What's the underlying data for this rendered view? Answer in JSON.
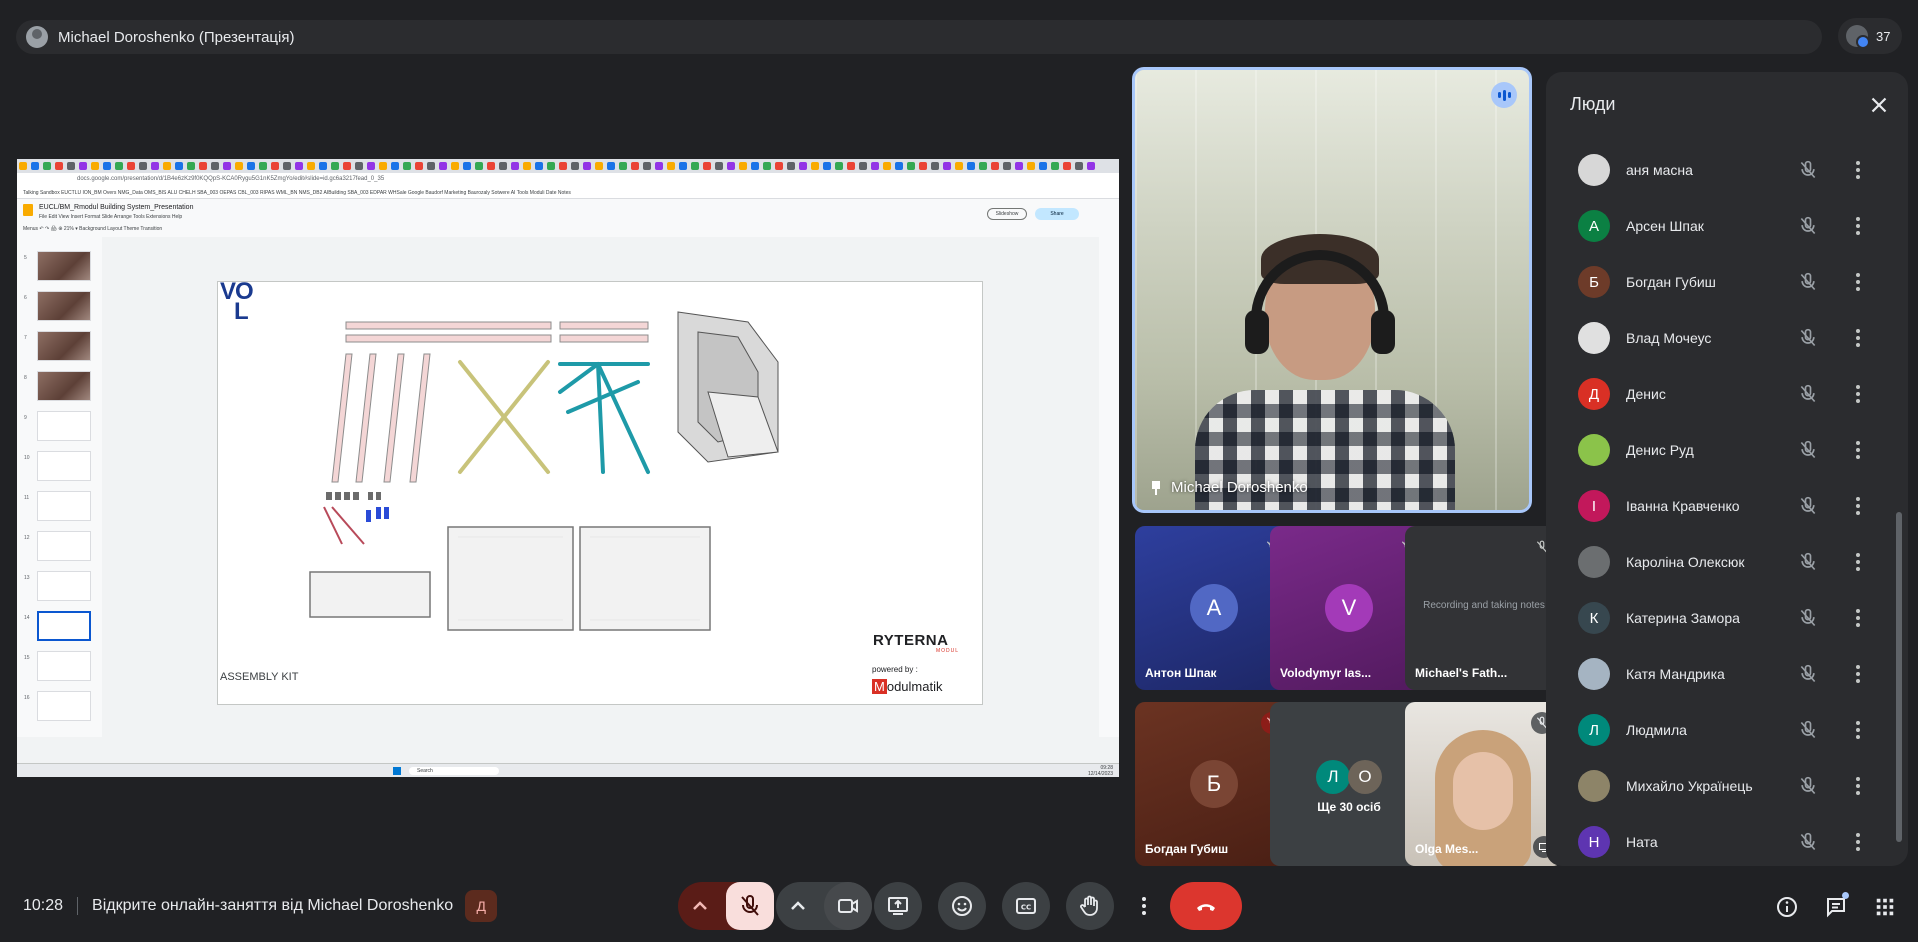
{
  "topbar": {
    "presenter_title": "Michael Doroshenko (Презентація)",
    "participant_count": "37"
  },
  "shared_screen": {
    "doc_title": "EUCL/BM_Rmodul Building System_Presentation",
    "url": "docs.google.com/presentation/d/1B4e6zKz9f0KQQpS-KCA0Rygu5G1nK5ZmgYo/edit#slide=id.gc6a3217fead_0_35",
    "menu": "File   Edit   View   Insert   Format   Slide   Arrange   Tools   Extensions   Help",
    "tools": "Menus   ↶   ↷   🖨   ⊕   21%   ▾      Background   Layout   Theme   Transition",
    "bookmarks": "Talking   Sandbox   EUCTLU   ION_BM   Overs   NMG_Data   OMS_BIS   ALU   CHELH   SBA_003   OEPAS   CBL_003   RIPAS   WML_BN   NMS_DB2   AIBuilding   SBA_003   EDPAR   WHSale   Google   Baudorf   Marketing   Baurozaly   Sotwere   AI   Tools   Moduli   Date   Notes",
    "slideshow_label": "Slideshow",
    "share_label": "Share",
    "thumb_numbers": [
      "5",
      "6",
      "7",
      "8",
      "9",
      "10",
      "11",
      "12",
      "13",
      "14",
      "15",
      "16"
    ],
    "slide": {
      "logo_line1": "VO",
      "logo_line2": "L",
      "caption": "ASSEMBLY KIT",
      "brand": "RYTERNA",
      "brand_sub": "MODUL",
      "powered_by": "powered by :",
      "partner_initial": "M",
      "partner_rest": "odulmatik"
    },
    "taskbar_search": "Search",
    "taskbar_time": "09:28",
    "taskbar_date": "12/14/2023"
  },
  "speaker": {
    "name": "Michael Doroshenko"
  },
  "tiles": [
    {
      "initial": "А",
      "name": "Антон Шпак",
      "bg": "#25348a",
      "circle": "#5168c4"
    },
    {
      "initial": "V",
      "name": "Volodymyr Ias...",
      "bg": "#6a1f7a",
      "circle": "#a33ab8"
    },
    {
      "initial": "",
      "name": "Michael's Fath...",
      "bg": "#323336",
      "caption": "Recording and taking notes"
    },
    {
      "initial": "Б",
      "name": "Богдан Губиш",
      "bg": "#5a2a1c",
      "circle": "#6e3a2a"
    },
    {
      "others_label": "Ще 30 осіб",
      "initials": [
        "Л",
        "О"
      ]
    },
    {
      "name": "Olga Mes...",
      "bg": "#d8d3cd"
    }
  ],
  "people_panel": {
    "title": "Люди",
    "participants": [
      {
        "name": "аня масна",
        "initial": "",
        "color": "#d7d7d7"
      },
      {
        "name": "Арсен Шпак",
        "initial": "А",
        "color": "#0b8043"
      },
      {
        "name": "Богдан Губиш",
        "initial": "Б",
        "color": "#6d3b29"
      },
      {
        "name": "Влад Мочеус",
        "initial": "",
        "color": "#e0e0e0"
      },
      {
        "name": "Денис",
        "initial": "Д",
        "color": "#d93025"
      },
      {
        "name": "Денис Руд",
        "initial": "",
        "color": "#8bc34a"
      },
      {
        "name": "Іванна Кравченко",
        "initial": "І",
        "color": "#c2185b"
      },
      {
        "name": "Кароліна Олексюк",
        "initial": "",
        "color": "#6b6e70"
      },
      {
        "name": "Катерина Замора",
        "initial": "К",
        "color": "#37474f"
      },
      {
        "name": "Катя Мандрика",
        "initial": "",
        "color": "#a5b4c2"
      },
      {
        "name": "Людмила",
        "initial": "Л",
        "color": "#00897b"
      },
      {
        "name": "Михайло Українець",
        "initial": "",
        "color": "#8d8468"
      },
      {
        "name": "Ната",
        "initial": "Н",
        "color": "#5e35b1"
      }
    ]
  },
  "bottom": {
    "time": "10:28",
    "meeting_title": "Відкрите онлайн-заняття від Michael Doroshenko",
    "host_badge": "Д"
  },
  "colors": {
    "background": "#202124",
    "panel": "#2b2c2f",
    "end_call": "#dc362e",
    "mic_off_bg": "#f9dedc",
    "accent_blue": "#a8c7fa"
  }
}
